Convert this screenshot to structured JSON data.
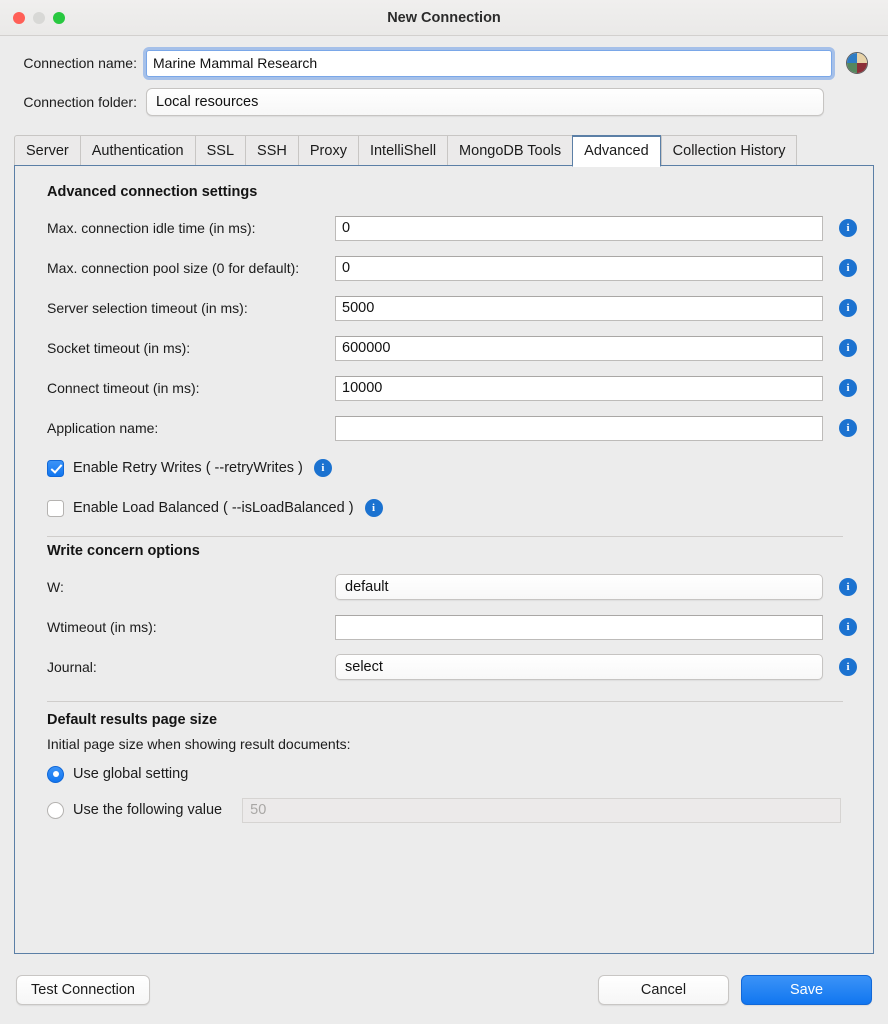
{
  "window": {
    "title": "New Connection",
    "traffic_lights": [
      "close",
      "minimize",
      "zoom"
    ]
  },
  "top_form": {
    "connection_name_label": "Connection name:",
    "connection_name_value": "Marine Mammal Research",
    "color_wheel_icon": "color-wheel-icon",
    "connection_folder_label": "Connection folder:",
    "connection_folder_value": "Local resources"
  },
  "tabs": [
    {
      "label": "Server",
      "active": false
    },
    {
      "label": "Authentication",
      "active": false
    },
    {
      "label": "SSL",
      "active": false
    },
    {
      "label": "SSH",
      "active": false
    },
    {
      "label": "Proxy",
      "active": false
    },
    {
      "label": "IntelliShell",
      "active": false
    },
    {
      "label": "MongoDB Tools",
      "active": false
    },
    {
      "label": "Advanced",
      "active": true
    },
    {
      "label": "Collection History",
      "active": false
    }
  ],
  "advanced": {
    "section_title": "Advanced connection settings",
    "fields": [
      {
        "label": "Max. connection idle time (in ms):",
        "value": "0",
        "info": "i"
      },
      {
        "label": "Max. connection pool size (0 for default):",
        "value": "0",
        "info": "i"
      },
      {
        "label": "Server selection timeout (in ms):",
        "value": "5000",
        "info": "i"
      },
      {
        "label": "Socket timeout (in ms):",
        "value": "600000",
        "info": "i"
      },
      {
        "label": "Connect timeout (in ms):",
        "value": "10000",
        "info": "i"
      },
      {
        "label": "Application name:",
        "value": "",
        "info": "i"
      }
    ],
    "checkboxes": [
      {
        "label": "Enable Retry Writes ( --retryWrites )",
        "checked": true,
        "info": "i"
      },
      {
        "label": "Enable Load Balanced ( --isLoadBalanced )",
        "checked": false,
        "info": "i"
      }
    ]
  },
  "write_concern": {
    "section_title": "Write concern options",
    "w_label": "W:",
    "w_value": "default",
    "wtimeout_label": "Wtimeout (in ms):",
    "wtimeout_value": "",
    "journal_label": "Journal:",
    "journal_value": "select",
    "info": "i"
  },
  "page_size": {
    "section_title": "Default results page size",
    "hint": "Initial page size when showing result documents:",
    "option_global_label": "Use global setting",
    "option_global_selected": true,
    "option_custom_label": "Use the following value",
    "option_custom_selected": false,
    "custom_placeholder": "50"
  },
  "footer": {
    "test_connection_label": "Test Connection",
    "cancel_label": "Cancel",
    "save_label": "Save"
  },
  "colors": {
    "accent": "#1176f0",
    "info_badge": "#1b72d0",
    "panel_border": "#5b7fa6",
    "window_bg": "#ececec"
  }
}
